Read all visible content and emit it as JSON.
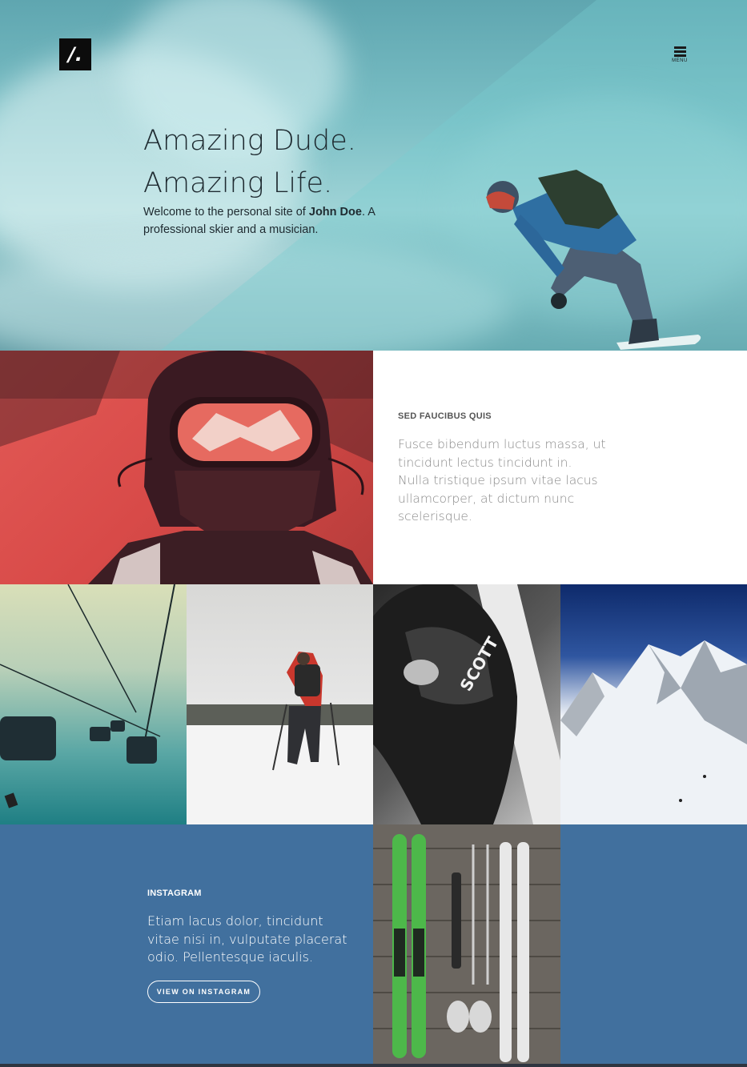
{
  "header": {
    "logo_text": "/.",
    "menu_label": "MENU"
  },
  "hero": {
    "title_line1": "Amazing Dude.",
    "title_line2": "Amazing Life.",
    "text_before": "Welcome to the personal site of ",
    "text_name": "John Doe",
    "text_after": ". A professional skier and a musician."
  },
  "feature": {
    "kicker": "SED FAUCIBUS QUIS",
    "body": "Fusce bibendum luctus massa, ut tincidunt lectus tincidunt in. Nulla tristique ipsum vitae lacus ullamcorper, at dictum nunc scelerisque."
  },
  "instagram": {
    "kicker": "INSTAGRAM",
    "body": "Etiam lacus dolor, tincidunt vitae nisi in, vulputate placerat odio. Pellentesque iaculis.",
    "button_label": "VIEW ON INSTAGRAM"
  },
  "colors": {
    "hero_tint": "#7cc0c6",
    "red_tint": "#d84a48",
    "blue_block": "#41709e"
  }
}
